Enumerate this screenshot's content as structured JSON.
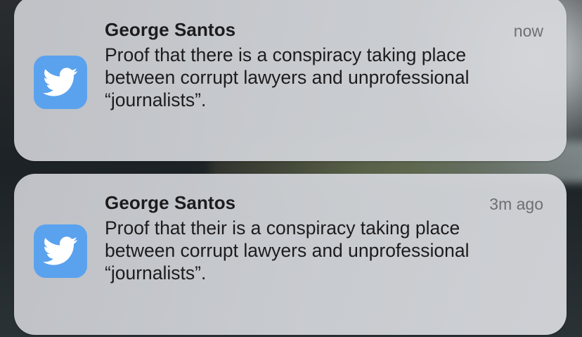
{
  "notifications": [
    {
      "app_icon": "twitter-bird-icon",
      "sender": "George Santos",
      "time": "now",
      "message_lines": [
        "Proof that there is a conspiracy taking place",
        "between corrupt lawyers and unprofessional",
        "“journalists”."
      ]
    },
    {
      "app_icon": "twitter-bird-icon",
      "sender": "George Santos",
      "time": "3m ago",
      "message_lines": [
        "Proof that their is a conspiracy taking place",
        "between corrupt lawyers and unprofessional",
        "“journalists”."
      ]
    }
  ],
  "colors": {
    "icon_background": "#5aa2ee",
    "card_background": "#cdd0d4",
    "text_primary": "#1c1c1e",
    "text_secondary": "#6e6f73"
  }
}
